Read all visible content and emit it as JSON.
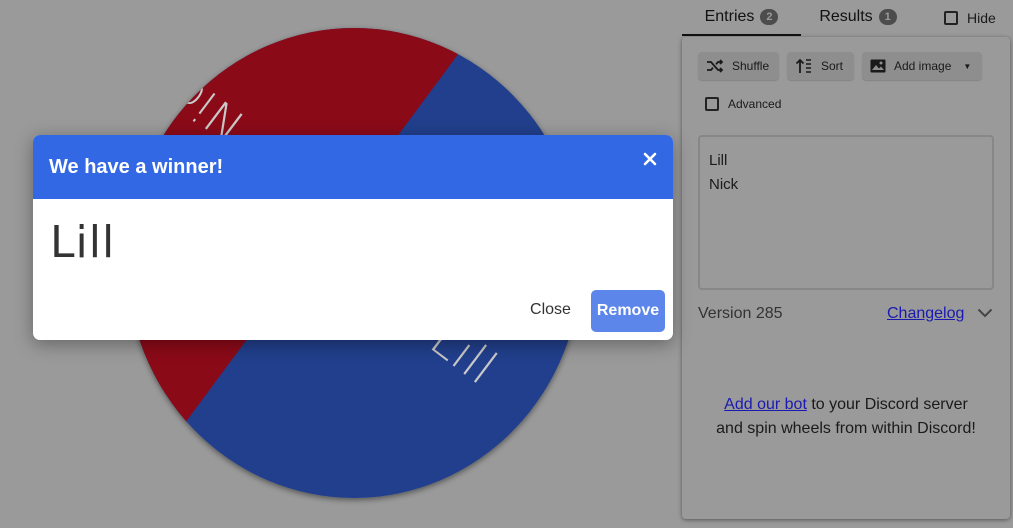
{
  "tabs": {
    "entries_label": "Entries",
    "entries_count": "2",
    "results_label": "Results",
    "results_count": "1",
    "hide_label": "Hide"
  },
  "toolbar": {
    "shuffle_label": "Shuffle",
    "sort_label": "Sort",
    "add_image_label": "Add image"
  },
  "advanced_label": "Advanced",
  "entries": [
    "Lill",
    "Nick"
  ],
  "footer": {
    "version": "Version 285",
    "changelog": "Changelog"
  },
  "discord": {
    "link": "Add our bot",
    "text": " to your Discord server and spin wheels from within Discord!"
  },
  "wheel": {
    "segments": [
      {
        "label": "Nick",
        "color": "#8b0a18"
      },
      {
        "label": "Lill",
        "color": "#213f8c"
      }
    ]
  },
  "modal": {
    "title": "We have a winner!",
    "winner": "Lill",
    "close_label": "Close",
    "remove_label": "Remove",
    "header_color": "#3268e4"
  }
}
